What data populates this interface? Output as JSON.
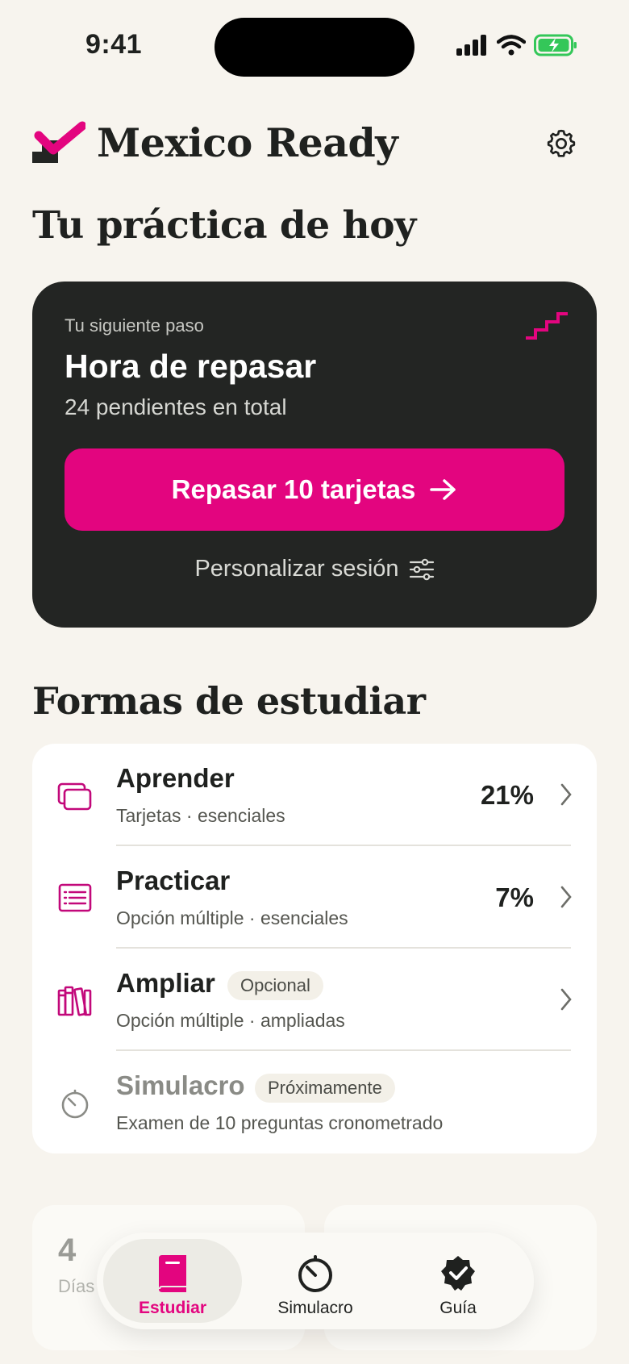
{
  "status": {
    "time": "9:41"
  },
  "header": {
    "app_title": "Mexico Ready",
    "page_heading": "Tu práctica de hoy"
  },
  "hero": {
    "kicker": "Tu siguiente paso",
    "title": "Hora de repasar",
    "subtitle": "24 pendientes en total",
    "cta_label": "Repasar 10 tarjetas",
    "personalize_label": "Personalizar sesión"
  },
  "study": {
    "heading": "Formas de estudiar",
    "items": [
      {
        "title": "Aprender",
        "subtitle": "Tarjetas · esenciales",
        "progress": "21%",
        "icon": "cards-icon"
      },
      {
        "title": "Practicar",
        "subtitle": "Opción múltiple · esenciales",
        "progress": "7%",
        "icon": "list-icon"
      },
      {
        "title": "Ampliar",
        "badge": "Opcional",
        "subtitle": "Opción múltiple · ampliadas",
        "icon": "books-icon"
      },
      {
        "title": "Simulacro",
        "badge": "Próximamente",
        "subtitle": "Examen de 10 preguntas cronometrado",
        "icon": "timer-icon"
      }
    ]
  },
  "stats": [
    {
      "value": "4",
      "label": "Días"
    },
    {
      "value": "",
      "label": ""
    }
  ],
  "tabs": [
    {
      "label": "Estudiar",
      "icon": "book-icon",
      "active": true
    },
    {
      "label": "Simulacro",
      "icon": "timer-icon"
    },
    {
      "label": "Guía",
      "icon": "verified-badge-icon"
    }
  ],
  "colors": {
    "accent": "#e3057f",
    "card_dark": "#232523",
    "background": "#f7f4ee"
  }
}
